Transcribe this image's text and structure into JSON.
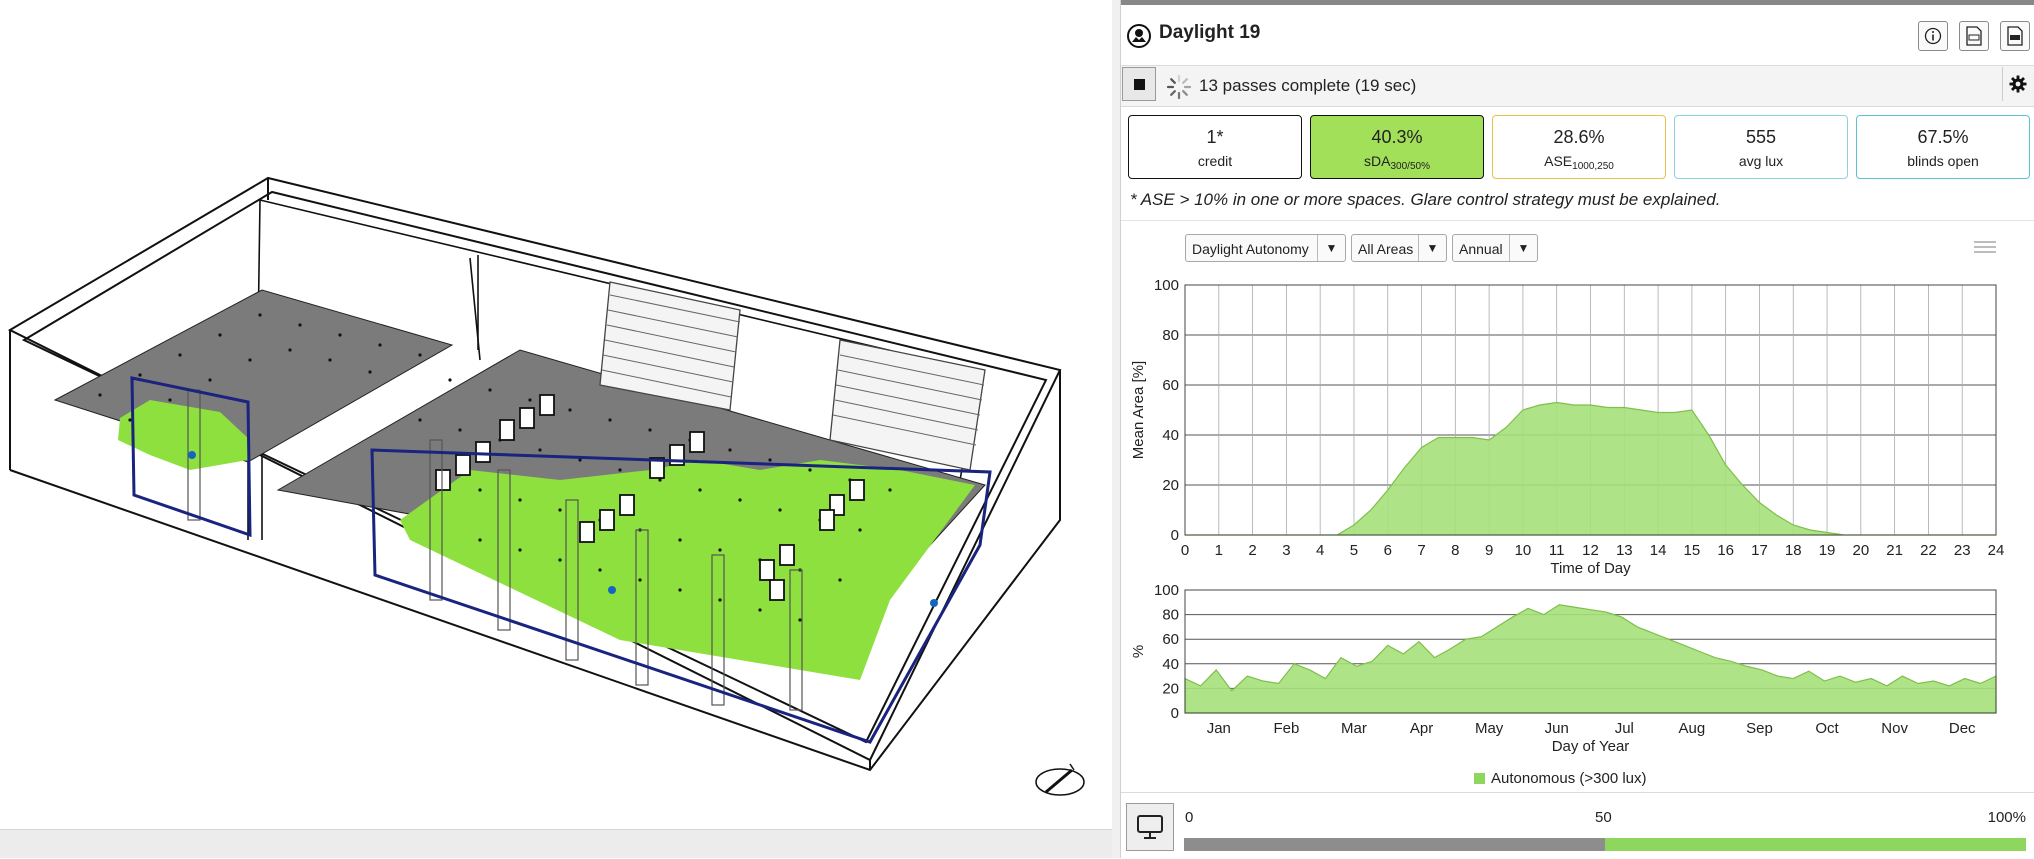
{
  "panel": {
    "title": "Daylight 19",
    "header_buttons": [
      "info-icon",
      "csv-icon",
      "pdf-icon"
    ],
    "status_text": "13 passes complete (19 sec)",
    "metrics": [
      {
        "value": "1*",
        "label": "credit",
        "sub": "",
        "border": "#111111",
        "bg": "#ffffff"
      },
      {
        "value": "40.3%",
        "label": "sDA",
        "sub": "300/50%",
        "border": "#111111",
        "bg": "#a3e05a"
      },
      {
        "value": "28.6%",
        "label": "ASE",
        "sub": "1000,250",
        "border": "#e8c24a",
        "bg": "#ffffff"
      },
      {
        "value": "555",
        "label": "avg lux",
        "sub": "",
        "border": "#8fd3e0",
        "bg": "#ffffff"
      },
      {
        "value": "67.5%",
        "label": "blinds open",
        "sub": "",
        "border": "#5cc3d6",
        "bg": "#ffffff"
      }
    ],
    "note": "* ASE > 10% in one or more spaces. Glare control strategy must be explained.",
    "dropdowns": {
      "metric": "Daylight Autonomy",
      "area": "All Areas",
      "period": "Annual"
    },
    "legend_label": "Autonomous (>300 lux)",
    "scale": {
      "min_label": "0",
      "mid_label": "50",
      "max_label": "100%",
      "split_fraction": 0.5
    }
  },
  "colors": {
    "accent_green": "#8ed65e",
    "fill_green": "#a6e07a",
    "series_line": "#7fbf4a"
  },
  "chart_data": [
    {
      "type": "area",
      "xlabel": "Time of Day",
      "ylabel": "Mean Area [%]",
      "xlim": [
        0,
        24
      ],
      "ylim": [
        0,
        100
      ],
      "xticks": [
        0,
        1,
        2,
        3,
        4,
        5,
        6,
        7,
        8,
        9,
        10,
        11,
        12,
        13,
        14,
        15,
        16,
        17,
        18,
        19,
        20,
        21,
        22,
        23,
        24
      ],
      "yticks": [
        0,
        20,
        40,
        60,
        80,
        100
      ],
      "grid": true,
      "x": [
        0,
        4.5,
        5,
        5.5,
        6,
        6.5,
        7,
        7.5,
        8,
        8.5,
        9,
        9.5,
        10,
        10.5,
        11,
        11.5,
        12,
        12.5,
        13,
        13.5,
        14,
        14.5,
        15,
        15.5,
        16,
        16.5,
        17,
        17.5,
        18,
        18.5,
        19,
        19.5,
        20,
        24
      ],
      "series": [
        {
          "name": "Autonomous (>300 lux)",
          "values": [
            0,
            0,
            4,
            10,
            18,
            27,
            35,
            39,
            39,
            39,
            38,
            43,
            50,
            52,
            53,
            52,
            52,
            51,
            51,
            50,
            49,
            49,
            50,
            40,
            28,
            20,
            13,
            8,
            4,
            2,
            1,
            0,
            0,
            0
          ]
        }
      ]
    },
    {
      "type": "area",
      "xlabel": "Day of Year",
      "ylabel": "%",
      "ylim": [
        0,
        100
      ],
      "yticks": [
        0,
        20,
        40,
        60,
        80,
        100
      ],
      "categories": [
        "Jan",
        "Feb",
        "Mar",
        "Apr",
        "May",
        "Jun",
        "Jul",
        "Aug",
        "Sep",
        "Oct",
        "Nov",
        "Dec"
      ],
      "grid": true,
      "x": [
        1,
        8,
        15,
        22,
        29,
        36,
        43,
        50,
        57,
        64,
        71,
        78,
        85,
        92,
        99,
        106,
        113,
        120,
        127,
        134,
        141,
        148,
        155,
        162,
        169,
        176,
        183,
        190,
        197,
        204,
        211,
        218,
        225,
        232,
        239,
        246,
        253,
        260,
        267,
        274,
        281,
        288,
        295,
        302,
        309,
        316,
        323,
        330,
        337,
        344,
        351,
        358,
        365
      ],
      "series": [
        {
          "name": "Autonomous (>300 lux)",
          "values": [
            28,
            22,
            35,
            18,
            30,
            26,
            24,
            40,
            35,
            28,
            45,
            38,
            42,
            55,
            48,
            58,
            45,
            52,
            60,
            62,
            70,
            78,
            85,
            80,
            88,
            86,
            84,
            82,
            78,
            70,
            65,
            60,
            55,
            50,
            45,
            42,
            38,
            35,
            30,
            28,
            34,
            26,
            30,
            25,
            28,
            22,
            30,
            24,
            26,
            22,
            28,
            24,
            30
          ]
        }
      ]
    }
  ]
}
